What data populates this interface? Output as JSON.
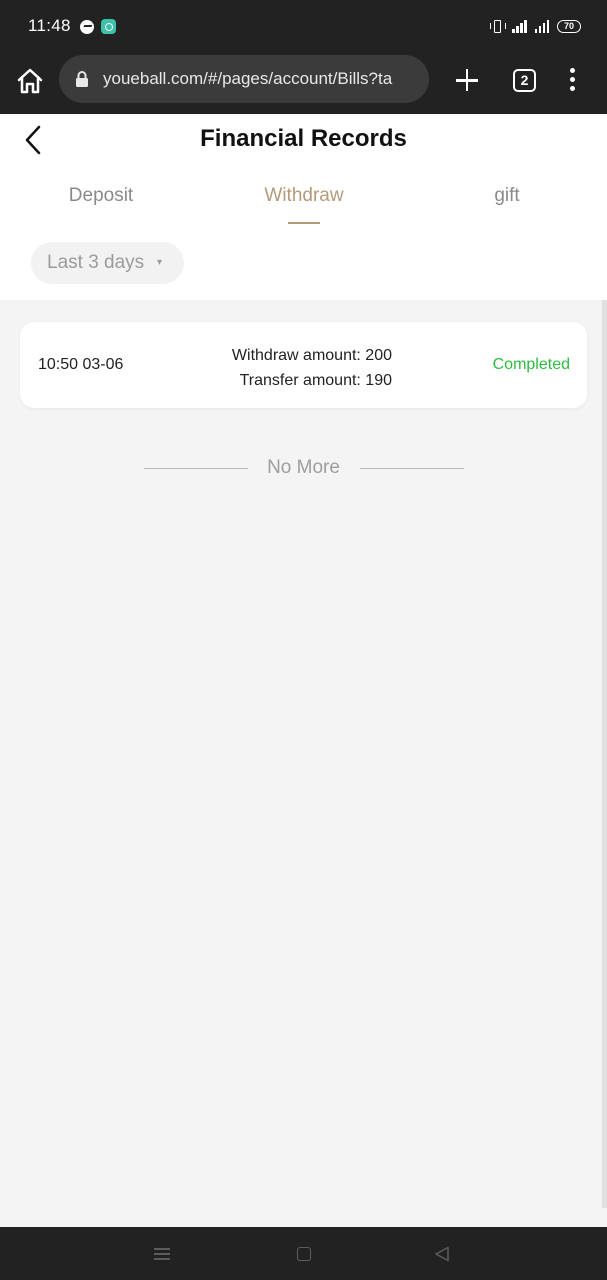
{
  "status_bar": {
    "time": "11:48",
    "battery": "70",
    "icons": [
      "messenger-icon",
      "app-notification-icon",
      "vibrate-icon",
      "signal-icon",
      "signal-icon",
      "battery-icon"
    ]
  },
  "browser": {
    "url": "youeball.com/#/pages/account/Bills?ta",
    "tab_count": "2"
  },
  "page": {
    "title": "Financial Records",
    "tabs": [
      {
        "label": "Deposit",
        "active": false
      },
      {
        "label": "Withdraw",
        "active": true
      },
      {
        "label": "gift",
        "active": false
      }
    ],
    "filter": {
      "label": "Last 3 days",
      "arrow": "▾"
    }
  },
  "records": [
    {
      "time": "10:50 03-06",
      "withdraw_amount": "Withdraw amount: 200",
      "transfer_amount": "Transfer amount: 190",
      "status": "Completed"
    }
  ],
  "footer_text": "No More",
  "colors": {
    "accent": "#b59a79",
    "status_completed": "#2dbd3e",
    "system_bar": "#222222",
    "page_bg": "#f4f4f4"
  }
}
